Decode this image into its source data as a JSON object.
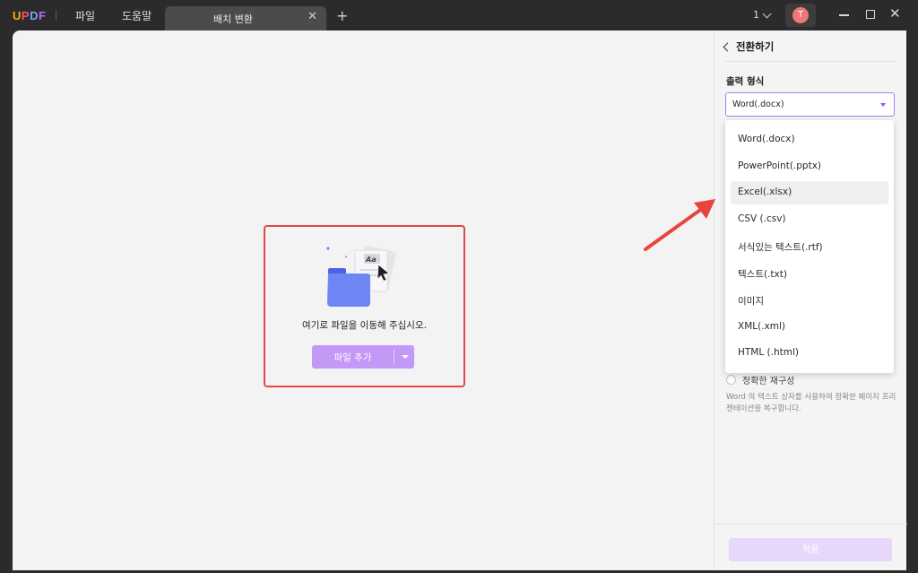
{
  "app": {
    "logo": "UPDF",
    "menu": [
      "파일",
      "도움말"
    ],
    "tab_title": "배치 변환",
    "page_count": "1",
    "avatar_initial": "T"
  },
  "dropzone": {
    "instruction": "여기로 파일을 이동해 주십시오.",
    "add_button": "파일 추가",
    "border_color": "#e04848",
    "button_color": "#c498f6"
  },
  "panel": {
    "title": "전환하기",
    "format_label": "출력 형식",
    "selected_format": "Word(.docx)",
    "accent_color": "#8c54f0",
    "option_label": "정확한 재구성",
    "option_desc": "Word 의 텍스트 상자를 사용하여 정확한 페이지 프리젠테이션을 복구합니다.",
    "apply_button": "적용"
  },
  "format_options": [
    "Word(.docx)",
    "PowerPoint(.pptx)",
    "Excel(.xlsx)",
    "CSV (.csv)",
    "서식있는 텍스트(.rtf)",
    "텍스트(.txt)",
    "이미지",
    "XML(.xml)",
    "HTML (.html)"
  ],
  "hovered_option": "Excel(.xlsx)",
  "annotation_arrow_color": "#e8453c"
}
